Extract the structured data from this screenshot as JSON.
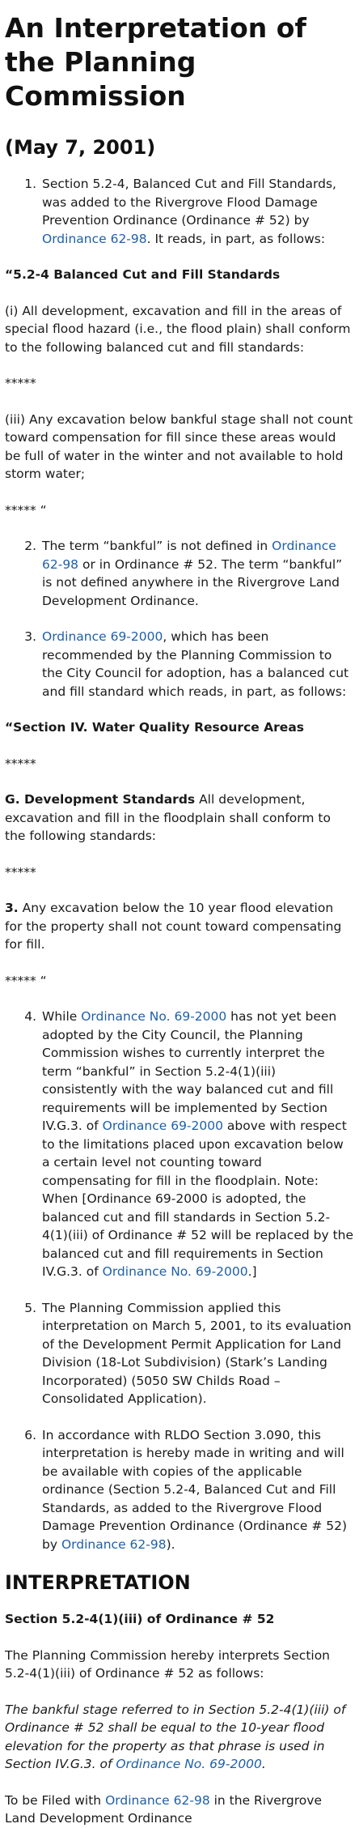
{
  "title": "An Interpretation of the Planning Commission",
  "date": "(May 7, 2001)",
  "list1": {
    "item1": {
      "before": "Section 5.2-4, Balanced Cut and Fill Standards, was added to the Rivergrove Flood Damage Prevention Ordinance (Ordinance # 52) by ",
      "link": "Ordinance 62-98",
      "after": ". It reads, in part, as follows:"
    }
  },
  "quote1": {
    "heading": "“5.2-4 Balanced Cut and Fill Standards",
    "para_i": "(i) All development, excavation and fill in the areas of special flood hazard (i.e., the flood plain) shall conform to the following balanced cut and fill standards:",
    "stars1": "*****",
    "para_iii": "(iii) Any excavation below bankful stage shall not count toward compensation for fill since these areas would be full of water in the winter and not available to hold storm water;",
    "stars_end": "***** “"
  },
  "list2": {
    "item2": {
      "before": "The term “bankful” is not defined in ",
      "link": "Ordinance 62-98",
      "after": " or in Ordinance # 52. The term “bankful” is not defined anywhere in the Rivergrove Land Development Ordinance."
    },
    "item3": {
      "link": "Ordinance 69-2000",
      "after": ", which has been recommended by the Planning Commission to the City Council for adoption, has a balanced cut and fill standard which reads, in part, as follows:"
    }
  },
  "quote2": {
    "heading": "“Section IV. Water Quality Resource Areas",
    "stars1": "*****",
    "g_label": "G. Development Standards",
    "g_text": " All development, excavation and fill in the floodplain shall conform to the following standards:",
    "stars2": "*****",
    "three_label": "3.",
    "three_text": " Any excavation below the 10 year flood elevation for the property shall not count toward compensating for fill.",
    "stars_end": "***** “"
  },
  "list3": {
    "item4": {
      "t1": "While ",
      "l1": "Ordinance No. 69-2000",
      "t2": " has not yet been adopted by the City Council, the Planning Commission wishes to currently interpret the term “bankful” in Section 5.2-4(1)(iii) consistently with the way balanced cut and fill requirements will be implemented by Section IV.G.3. of ",
      "l2": "Ordinance 69-2000",
      "t3": " above with respect to the limitations placed upon excavation below a certain level not counting toward compensating for fill in the floodplain. Note: When [Ordinance 69-2000 is adopted, the balanced cut and fill standards in Section 5.2-4(1)(iii) of Ordinance # 52 will be replaced by the balanced cut and fill requirements in Section IV.G.3. of ",
      "l3": "Ordinance No. 69-2000",
      "t4": ".]"
    },
    "item5": "The Planning Commission applied this interpretation on March 5, 2001, to its evaluation of the Development Permit Application for Land Division (18-Lot Subdivision) (Stark’s Landing Incorporated) (5050 SW Childs Road – Consolidated Application).",
    "item6": {
      "before": "In accordance with RLDO Section 3.090, this interpretation is hereby made in writing and will be available with copies of the applicable ordinance (Section 5.2-4, Balanced Cut and Fill Standards, as added to the Rivergrove Flood Damage Prevention Ordinance (Ordinance # 52) by ",
      "link": "Ordinance 62-98",
      "after": ")."
    }
  },
  "interpretation": {
    "heading": "INTERPRETATION",
    "subheading": "Section 5.2-4(1)(iii) of Ordinance # 52",
    "intro": "The Planning Commission hereby interprets Section 5.2-4(1)(iii) of Ordinance # 52 as follows:",
    "italic_text": "The bankful stage referred to in Section 5.2-4(1)(iii) of Ordinance # 52 shall be equal to the 10-year flood elevation for the property as that phrase is used in Section IV.G.3. of ",
    "italic_link": "Ordinance No. 69-2000",
    "italic_end": ".",
    "filed_before": "To be Filed with ",
    "filed_link": "Ordinance 62-98",
    "filed_after": " in the Rivergrove Land Development Ordinance"
  }
}
